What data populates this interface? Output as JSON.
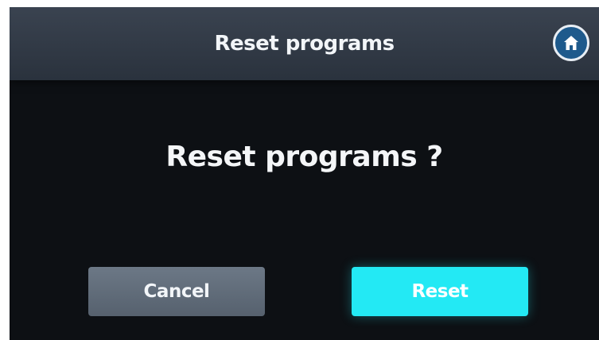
{
  "header": {
    "title": "Reset programs",
    "home_icon": "home-icon"
  },
  "dialog": {
    "question": "Reset programs ?"
  },
  "buttons": {
    "cancel_label": "Cancel",
    "reset_label": "Reset"
  },
  "colors": {
    "screen_background": "#0d1014",
    "header_background": "#333b46",
    "cancel_button": "#616c79",
    "reset_button": "#23e9f4",
    "text": "#f2f5f8"
  }
}
